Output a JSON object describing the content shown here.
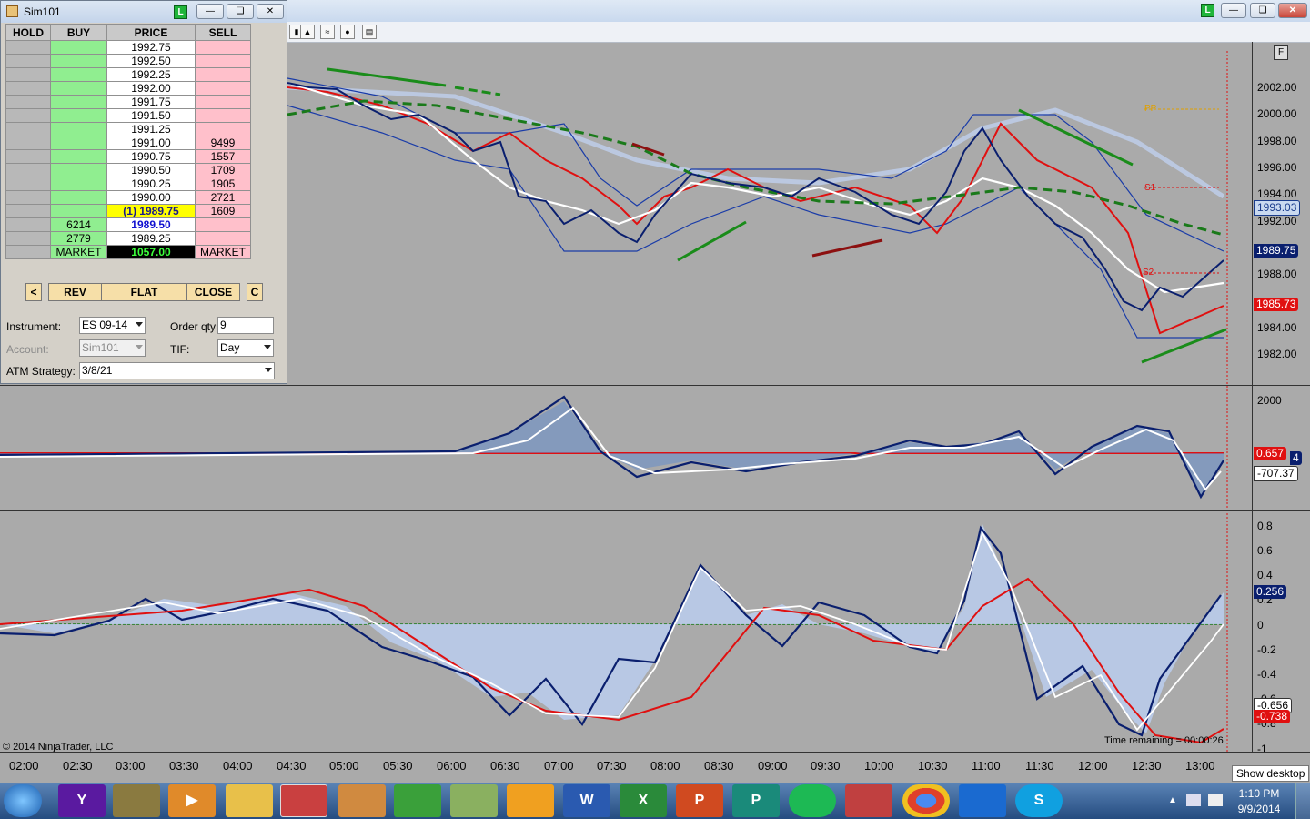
{
  "chart_window": {
    "buttons": [
      "L"
    ],
    "price_axis_labels": [
      "2002.00",
      "2000.00",
      "1998.00",
      "1996.00",
      "1994.00",
      "1992.00",
      "1988.00",
      "1984.00",
      "1982.00"
    ],
    "price_tags": [
      {
        "text": "1993.03",
        "bg": "#c9d9f0",
        "fg": "#1a3c8c"
      },
      {
        "text": "1989.75",
        "bg": "#0a1f6e",
        "fg": "#ffffff"
      },
      {
        "text": "1985.73",
        "bg": "#e01010",
        "fg": "#ffffff"
      }
    ],
    "level_labels": {
      "pp": "PP",
      "s1": "S1",
      "s2": "S2"
    },
    "panel2_axis": "2000",
    "panel2_tags": [
      {
        "text": "0.657",
        "bg": "#e01010",
        "fg": "#ffffff"
      },
      {
        "text": "4",
        "bg": "#0a1f6e",
        "fg": "#ffffff"
      },
      {
        "text": "-707.37",
        "bg": "#ffffff",
        "fg": "#000000"
      }
    ],
    "panel3_axis": [
      "0.8",
      "0.6",
      "0.4",
      "0.2",
      "0",
      "-0.2",
      "-0.4",
      "-0.6",
      "-0.8",
      "-1"
    ],
    "panel3_tags": [
      {
        "text": "0.256",
        "bg": "#0a1f6e",
        "fg": "#ffffff"
      },
      {
        "text": "-0.656",
        "bg": "#ffffff",
        "fg": "#000000"
      },
      {
        "text": "-0.738",
        "bg": "#e01010",
        "fg": "#ffffff"
      }
    ],
    "copyright": "© 2014 NinjaTrader, LLC",
    "time_remaining": "Time remaining = 00:00:26",
    "x_labels": [
      "02:00",
      "02:30",
      "03:00",
      "03:30",
      "04:00",
      "04:30",
      "05:00",
      "05:30",
      "06:00",
      "06:30",
      "07:00",
      "07:30",
      "08:00",
      "08:30",
      "09:00",
      "09:30",
      "10:00",
      "10:30",
      "11:00",
      "11:30",
      "12:00",
      "12:30",
      "13:00"
    ],
    "f_button": "F"
  },
  "dom": {
    "title": "Sim101",
    "l_badge": "L",
    "headers": {
      "hold": "HOLD",
      "buy": "BUY",
      "price": "PRICE",
      "sell": "SELL"
    },
    "rows": [
      {
        "buy": "",
        "price": "1992.75",
        "sell": ""
      },
      {
        "buy": "",
        "price": "1992.50",
        "sell": ""
      },
      {
        "buy": "",
        "price": "1992.25",
        "sell": ""
      },
      {
        "buy": "",
        "price": "1992.00",
        "sell": ""
      },
      {
        "buy": "",
        "price": "1991.75",
        "sell": ""
      },
      {
        "buy": "",
        "price": "1991.50",
        "sell": ""
      },
      {
        "buy": "",
        "price": "1991.25",
        "sell": ""
      },
      {
        "buy": "",
        "price": "1991.00",
        "sell": "9499"
      },
      {
        "buy": "",
        "price": "1990.75",
        "sell": "1557"
      },
      {
        "buy": "",
        "price": "1990.50",
        "sell": "1709"
      },
      {
        "buy": "",
        "price": "1990.25",
        "sell": "1905"
      },
      {
        "buy": "",
        "price": "1990.00",
        "sell": "2721"
      },
      {
        "buy": "",
        "price": "(1) 1989.75",
        "sell": "1609"
      },
      {
        "buy": "6214",
        "price": "1989.50",
        "sell": ""
      },
      {
        "buy": "2779",
        "price": "1989.25",
        "sell": ""
      }
    ],
    "market": {
      "buy": "MARKET",
      "price": "1057.00",
      "sell": "MARKET"
    },
    "buttons": {
      "left": "<",
      "rev": "REV",
      "flat": "FLAT",
      "close": "CLOSE",
      "c": "C"
    },
    "instrument_label": "Instrument:",
    "instrument_value": "ES 09-14",
    "order_qty_label": "Order qty:",
    "order_qty_value": "9",
    "account_label": "Account:",
    "account_value": "Sim101",
    "tif_label": "TIF:",
    "tif_value": "Day",
    "atm_label": "ATM Strategy:",
    "atm_value": "3/8/21"
  },
  "taskbar": {
    "apps": [
      "start-orb",
      "yahoo",
      "game",
      "media",
      "explorer",
      "ninjatrader",
      "navigator",
      "app-green",
      "app-paper",
      "outlook",
      "word",
      "excel",
      "powerpoint",
      "publisher",
      "spotify",
      "app-red",
      "chrome",
      "teamviewer",
      "skype"
    ],
    "time": "1:10 PM",
    "date": "9/9/2014",
    "show_desktop": "Show desktop"
  }
}
